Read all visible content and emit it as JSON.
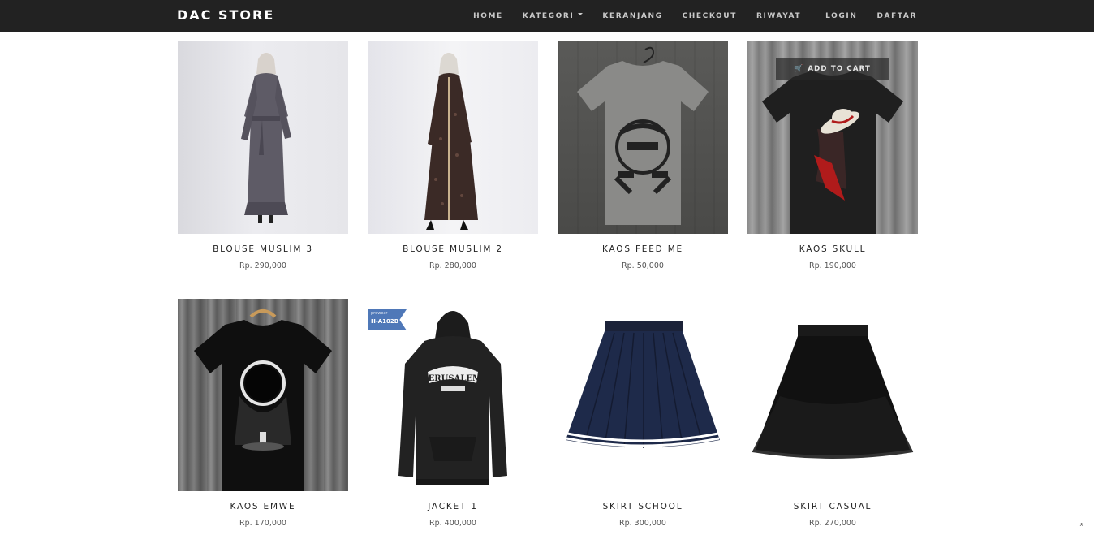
{
  "header": {
    "brand": "DAC STORE",
    "nav": [
      {
        "label": "HOME"
      },
      {
        "label": "KATEGORI",
        "has_dropdown": true
      },
      {
        "label": "KERANJANG"
      },
      {
        "label": "CHECKOUT"
      },
      {
        "label": "RIWAYAT"
      },
      {
        "label": "LOGIN"
      },
      {
        "label": "DAFTAR"
      }
    ]
  },
  "products": [
    {
      "name": "BLOUSE MUSLIM 3",
      "price": "Rp. 290,000",
      "image": "gray-abaya-model"
    },
    {
      "name": "BLOUSE MUSLIM 2",
      "price": "Rp. 280,000",
      "image": "batik-dress-model"
    },
    {
      "name": "KAOS FEED ME",
      "price": "Rp. 50,000",
      "image": "gray-tshirt-doublle-d"
    },
    {
      "name": "KAOS SKULL",
      "price": "Rp. 190,000",
      "image": "black-tshirt-straw-hat",
      "hover_button": "ADD TO CART"
    },
    {
      "name": "KAOS EMWE",
      "price": "Rp. 170,000",
      "image": "black-tshirt-eclipse"
    },
    {
      "name": "JACKET 1",
      "price": "Rp. 400,000",
      "image": "black-hoodie-jerusalem",
      "badge_top": "prewear",
      "badge_code": "H-A102B",
      "print_text": "JERUSALEM"
    },
    {
      "name": "SKIRT SCHOOL",
      "price": "Rp. 300,000",
      "image": "navy-pleated-skirt"
    },
    {
      "name": "SKIRT CASUAL",
      "price": "Rp. 270,000",
      "image": "black-tulle-skirt"
    }
  ],
  "icons": {
    "cart": "shopping-cart-icon",
    "scroll_top": "double-chevron-up-icon"
  },
  "colors": {
    "navbar_bg": "#222222",
    "nav_text": "#c9c9c9",
    "brand_text": "#ffffff"
  }
}
